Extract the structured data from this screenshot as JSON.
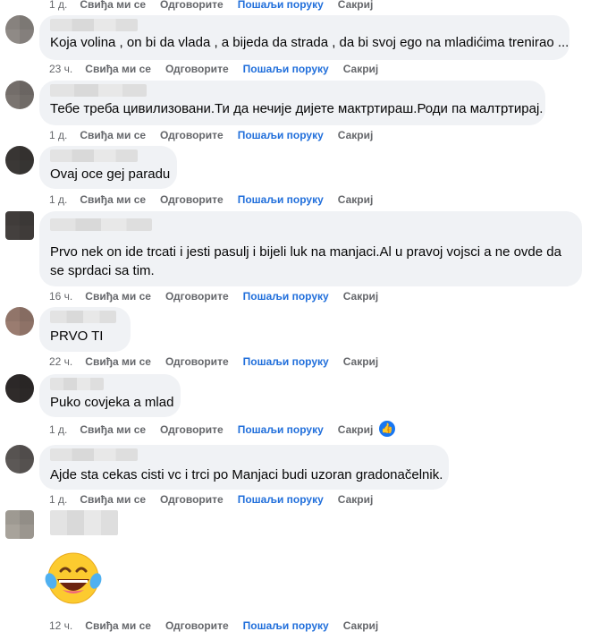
{
  "actions": {
    "like": "Свиђа ми се",
    "reply": "Одговорите",
    "send_message": "Пошаљи поруку",
    "hide": "Сакриј"
  },
  "comments": [
    {
      "text": "",
      "time": "1 д."
    },
    {
      "text": "Koja volina , on bi da vlada , a bijeda da strada , da bi svoj ego na mladićima trenirao ...",
      "time": "23 ч."
    },
    {
      "text": "Тебе треба цивилизовани.Ти да нечије дијете мактртираш.Роди па малтртирај.",
      "time": "1 д."
    },
    {
      "text": "Ovaj oce gej paradu",
      "time": "1 д."
    },
    {
      "text_line1": "Prvo nek on ide trcati i jesti pasulj i bijeli luk na manjaci.Al u pravoj vojsci a ne ovde da",
      "text_line2": "se sprdaci sa tim.",
      "time": "16 ч."
    },
    {
      "text": "PRVO TI",
      "time": "22 ч."
    },
    {
      "text": "Puko covjeka a mlad",
      "time": "1 д.",
      "reaction_icon": "like-icon"
    },
    {
      "text": "Ajde sta cekas cisti vc i trci po Manjaci budi uzoran gradonačelnik.",
      "time": "1 д."
    },
    {
      "text": "",
      "time": "12 ч.",
      "emoji": "laughing-tears-emoji"
    }
  ]
}
